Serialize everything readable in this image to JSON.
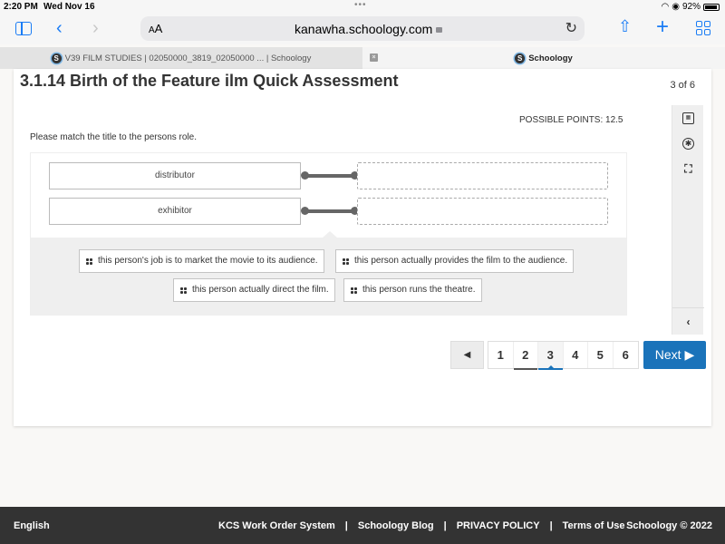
{
  "status_bar": {
    "time": "2:20 PM",
    "date": "Wed Nov 16",
    "battery": "92%",
    "battery_level": 0.92
  },
  "browser": {
    "text_size_label": "AA",
    "url": "kanawha.schoology.com",
    "tabs": [
      {
        "label": "V39 FILM STUDIES | 02050000_3819_02050000 ... | Schoology",
        "active": false
      },
      {
        "label": "Schoology",
        "active": true
      }
    ],
    "tab_close_glyph": "×",
    "favicon_letter": "S"
  },
  "assessment": {
    "title": "3.1.14 Birth of the Feature ilm Quick Assessment",
    "counter": "3 of 6",
    "possible_points": "POSSIBLE POINTS: 12.5",
    "question": "Please match the title to the persons role.",
    "terms": [
      "distributor",
      "exhibitor"
    ],
    "answer_choices": [
      "this person's job is to market the movie to its audience.",
      "this person actually provides the film to the audience.",
      "this person actually direct the film.",
      "this person runs the theatre."
    ]
  },
  "tools": {
    "calculator_icon": "calculator-icon",
    "accessibility_icon": "accessibility-icon",
    "fullscreen_icon": "expand-icon",
    "collapse_glyph": "‹"
  },
  "pagination": {
    "prev_glyph": "◀",
    "pages": [
      "1",
      "2",
      "3",
      "4",
      "5",
      "6"
    ],
    "current": "3",
    "next_label": "Next ▶"
  },
  "footer": {
    "language": "English",
    "links": [
      "KCS Work Order System",
      "Schoology Blog",
      "PRIVACY POLICY",
      "Terms of Use"
    ],
    "separator": "|",
    "copyright": "Schoology © 2022"
  }
}
